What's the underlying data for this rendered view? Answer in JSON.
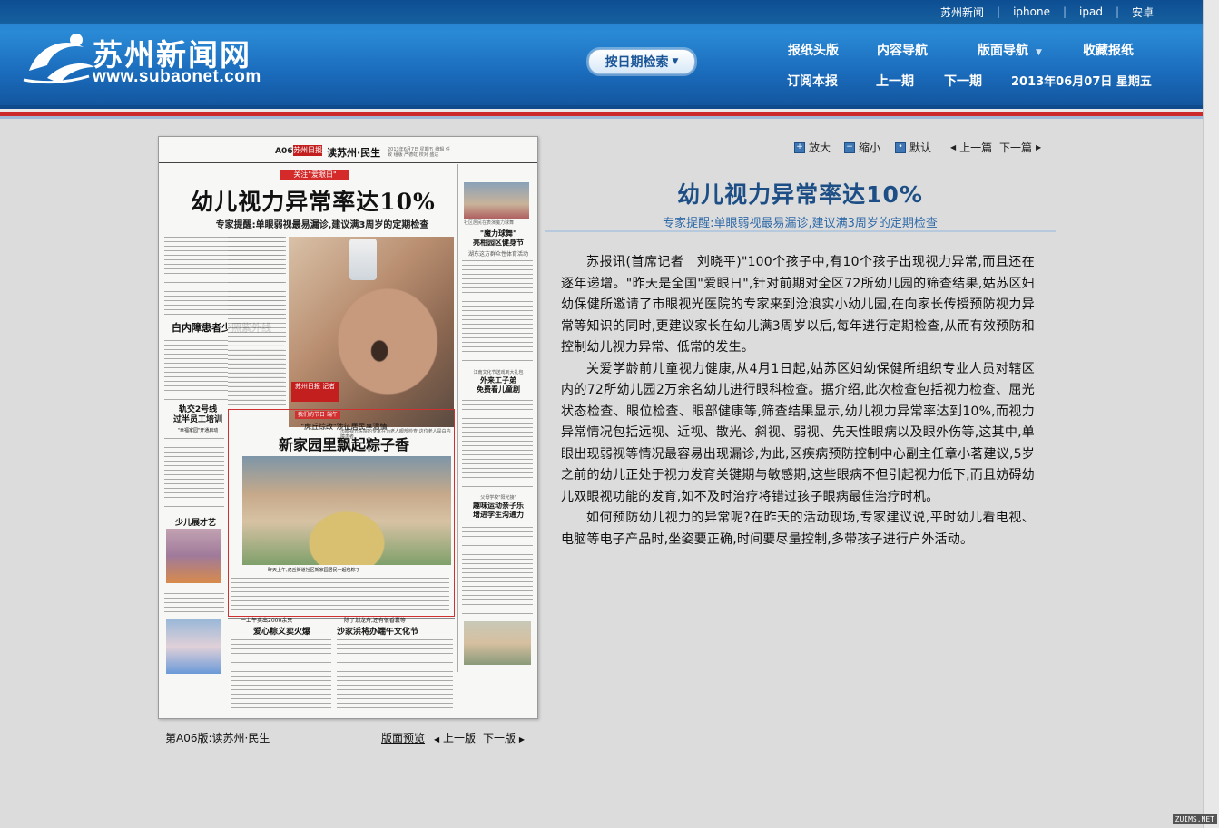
{
  "top_links": [
    "苏州新闻",
    "iphone",
    "ipad",
    "安卓"
  ],
  "logo": {
    "title": "苏州新闻网",
    "url": "www.subaonet.com"
  },
  "header": {
    "date_search_label": "按日期检索",
    "nav_row1": [
      "报纸头版",
      "内容导航",
      "版面导航",
      "收藏报纸"
    ],
    "nav_row2": [
      "订阅本报",
      "上一期",
      "下一期"
    ],
    "date": "2013年06月07日 星期五"
  },
  "paper": {
    "code": "A06",
    "masthead": "苏州日报",
    "section": "读苏州·民生",
    "meta": "2013年6月7日 星期五 编辑 任致 组版 严德虹 校对 盛达",
    "tag": "关注\"爱眼日\"",
    "headline": "幼儿视力异常率达10%",
    "deck": "专家提醒:单眼弱视最易漏诊,建议满3周岁的定期检查",
    "side_head1": "\"魔力球舞\"\n亮相园区健身节",
    "side_sub1": "湖东这方群众性体育活动",
    "side_caption1": "社区居民在表演魔力球舞",
    "stamp": "苏州日报 记者",
    "photo_caption": "市眼视光医院的专家在为老人眼部检查,这位老人是白内障患者",
    "subhead2": "白内障患者少照紫外线",
    "subhead3": "轨交2号线\n过半员工培训",
    "subhead3_sub": "\"幸福家园\"开通启动",
    "side_top": "江南文化节送戏到大礼包",
    "side_head2": "外来工子弟\n免费看儿童剧",
    "red_banner": "我们的节日·端午",
    "box_kicker": "\"虎丘综改\"涉征居民享温情",
    "box_headline": "新家园里飘起粽子香",
    "zongzi_caption": "昨天上午,虎丘街道社区新家园居民一起包粽子",
    "kids_head": "少儿展才艺",
    "subhead4_kicker": "一上午卖出2000余只",
    "subhead4": "爱心粽义卖火爆",
    "subhead5_kicker": "除了划龙舟,还有很香囊等",
    "subhead5": "沙家浜将办端午文化节",
    "side_kicker3": "父母学校\"阳光接\"",
    "side_head3": "趣味运动亲子乐\n增进学生沟通力"
  },
  "page_nav": {
    "label": "第A06版:读苏州·民生",
    "preview": "版面预览",
    "prev": "上一版",
    "next": "下一版"
  },
  "toolbar": {
    "zoom_in": "放大",
    "zoom_out": "缩小",
    "default": "默认",
    "prev_article": "上一篇",
    "next_article": "下一篇"
  },
  "article": {
    "title": "幼儿视力异常率达10%",
    "subtitle": "专家提醒:单眼弱视最易漏诊,建议满3周岁的定期检查",
    "paragraphs": [
      "苏报讯(首席记者　刘晓平)\"100个孩子中,有10个孩子出现视力异常,而且还在逐年递增。\"昨天是全国\"爱眼日\",针对前期对全区72所幼儿园的筛查结果,姑苏区妇幼保健所邀请了市眼视光医院的专家来到沧浪实小幼儿园,在向家长传授预防视力异常等知识的同时,更建议家长在幼儿满3周岁以后,每年进行定期检查,从而有效预防和控制幼儿视力异常、低常的发生。",
      "关爱学龄前儿童视力健康,从4月1日起,姑苏区妇幼保健所组织专业人员对辖区内的72所幼儿园2万余名幼儿进行眼科检查。据介绍,此次检查包括视力检查、屈光状态检查、眼位检查、眼部健康等,筛查结果显示,幼儿视力异常率达到10%,而视力异常情况包括远视、近视、散光、斜视、弱视、先天性眼病以及眼外伤等,这其中,单眼出现弱视等情况最容易出现漏诊,为此,区疾病预防控制中心副主任章小茗建议,5岁之前的幼儿正处于视力发育关键期与敏感期,这些眼病不但引起视力低下,而且妨碍幼儿双眼视功能的发育,如不及时治疗将错过孩子眼病最佳治疗时机。",
      "如何预防幼儿视力的异常呢?在昨天的活动现场,专家建议说,平时幼儿看电视、电脑等电子产品时,坐姿要正确,时间要尽量控制,多带孩子进行户外活动。"
    ]
  },
  "watermark": "ZUIMS.NET",
  "colors": {
    "header_blue": "#1e72c0",
    "title_blue": "#1d4f86",
    "accent_red": "#cc2a2a"
  }
}
